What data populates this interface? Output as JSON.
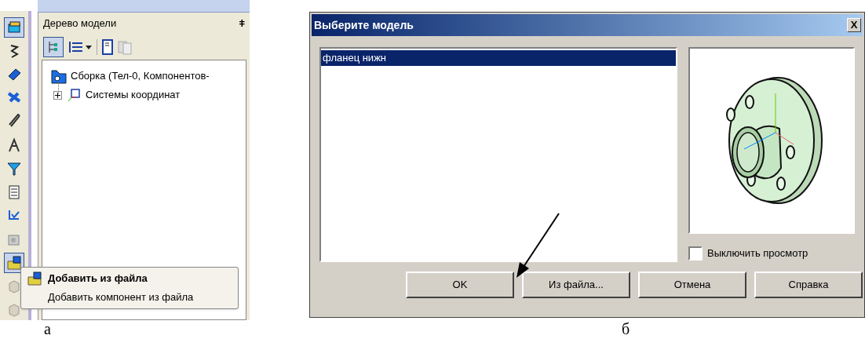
{
  "figure_a": {
    "toolbar": [
      {
        "selected": true
      },
      {
        "selected": false
      },
      {
        "selected": false
      },
      {
        "selected": false
      },
      {
        "selected": false
      },
      {
        "selected": false
      },
      {
        "selected": false
      },
      {
        "selected": false
      },
      {
        "selected": false
      },
      {
        "selected": false
      },
      {
        "selected": true
      },
      {
        "selected": false
      },
      {
        "selected": false
      }
    ],
    "panel": {
      "title": "Дерево модели",
      "pin": "ǂ",
      "tree": [
        {
          "label": "Сборка (Тел-0, Компонентов-",
          "expanded": true,
          "children": [
            {
              "label": "Системы координат",
              "expanded": false
            }
          ]
        }
      ]
    },
    "tooltip": {
      "title": "Добавить из файла",
      "description": "Добавить компонент из файла"
    },
    "caption": "а"
  },
  "figure_b": {
    "dialog": {
      "title": "Выберите модель",
      "close": "X",
      "models": [
        {
          "label": "фланец нижн",
          "selected": true
        }
      ],
      "preview_checkbox": {
        "label": "Выключить просмотр",
        "checked": false
      },
      "buttons": [
        "OK",
        "Из файла...",
        "Отмена",
        "Справка"
      ]
    },
    "caption": "б"
  }
}
